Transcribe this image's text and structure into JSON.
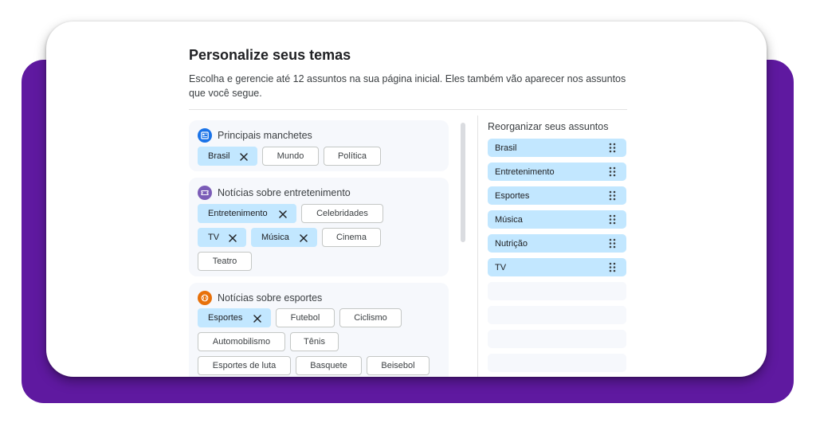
{
  "page": {
    "title": "Personalize seus temas",
    "description": "Escolha e gerencie até 12 assuntos na sua página inicial. Eles também vão aparecer nos assuntos que você segue."
  },
  "categories": [
    {
      "title": "Principais manchetes",
      "icon": "news-icon",
      "icon_color": "#1a73e8",
      "chips": [
        {
          "label": "Brasil",
          "selected": true
        },
        {
          "label": "Mundo",
          "selected": false
        },
        {
          "label": "Política",
          "selected": false
        }
      ]
    },
    {
      "title": "Notícias sobre entretenimento",
      "icon": "ticket-icon",
      "icon_color": "#7b5cb7",
      "chips": [
        {
          "label": "Entretenimento",
          "selected": true
        },
        {
          "label": "Celebridades",
          "selected": false
        },
        {
          "label": "TV",
          "selected": true
        },
        {
          "label": "Música",
          "selected": true
        },
        {
          "label": "Cinema",
          "selected": false
        },
        {
          "label": "Teatro",
          "selected": false
        }
      ]
    },
    {
      "title": "Notícias sobre esportes",
      "icon": "ball-icon",
      "icon_color": "#e8710a",
      "chips": [
        {
          "label": "Esportes",
          "selected": true
        },
        {
          "label": "Futebol",
          "selected": false
        },
        {
          "label": "Ciclismo",
          "selected": false
        },
        {
          "label": "Automobilismo",
          "selected": false
        },
        {
          "label": "Tênis",
          "selected": false
        },
        {
          "label": "Esportes de luta",
          "selected": false
        },
        {
          "label": "Basquete",
          "selected": false
        },
        {
          "label": "Beisebol",
          "selected": false
        }
      ]
    }
  ],
  "reorder": {
    "title": "Reorganizar seus assuntos",
    "items": [
      "Brasil",
      "Entretenimento",
      "Esportes",
      "Música",
      "Nutrição",
      "TV"
    ]
  },
  "colors": {
    "frame_accent": "#5f19a0",
    "selected_chip": "#c2e7ff",
    "card_background": "#f6f8fc"
  }
}
